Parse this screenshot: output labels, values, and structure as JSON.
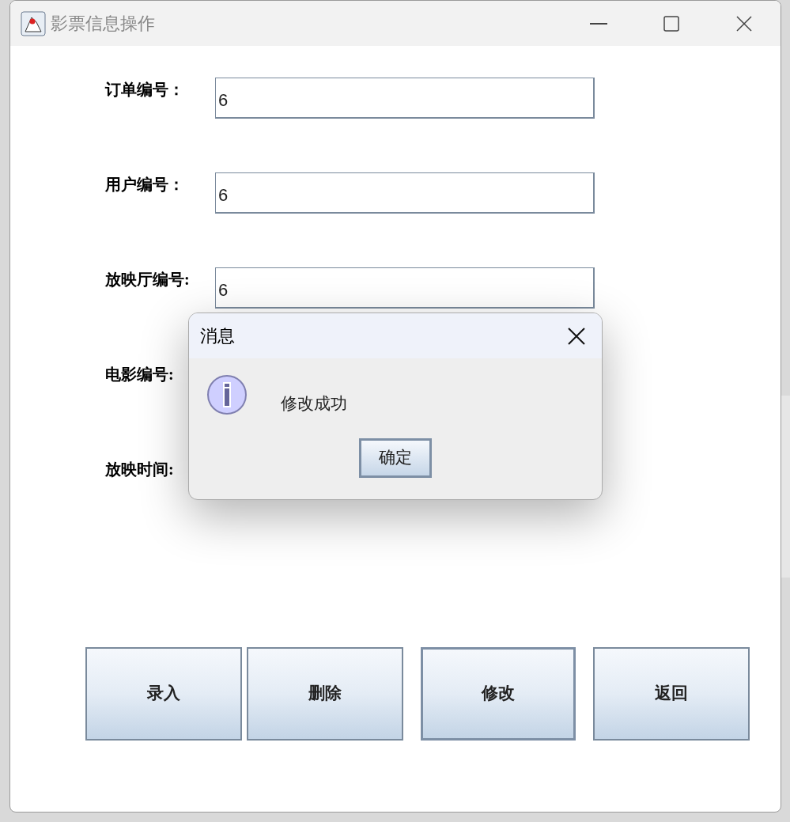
{
  "window": {
    "title": "影票信息操作"
  },
  "fields": [
    {
      "label": "订单编号：",
      "value": "6"
    },
    {
      "label": "用户编号：",
      "value": "6"
    },
    {
      "label": "放映厅编号:",
      "value": "6"
    },
    {
      "label": "电影编号:"
    },
    {
      "label": "放映时间:"
    }
  ],
  "buttons": [
    {
      "label": "录入",
      "focused": false
    },
    {
      "label": "删除",
      "focused": false
    },
    {
      "label": "修改",
      "focused": true
    },
    {
      "label": "返回",
      "focused": false
    }
  ],
  "dialog": {
    "title": "消息",
    "message": "修改成功",
    "button": "确定"
  }
}
